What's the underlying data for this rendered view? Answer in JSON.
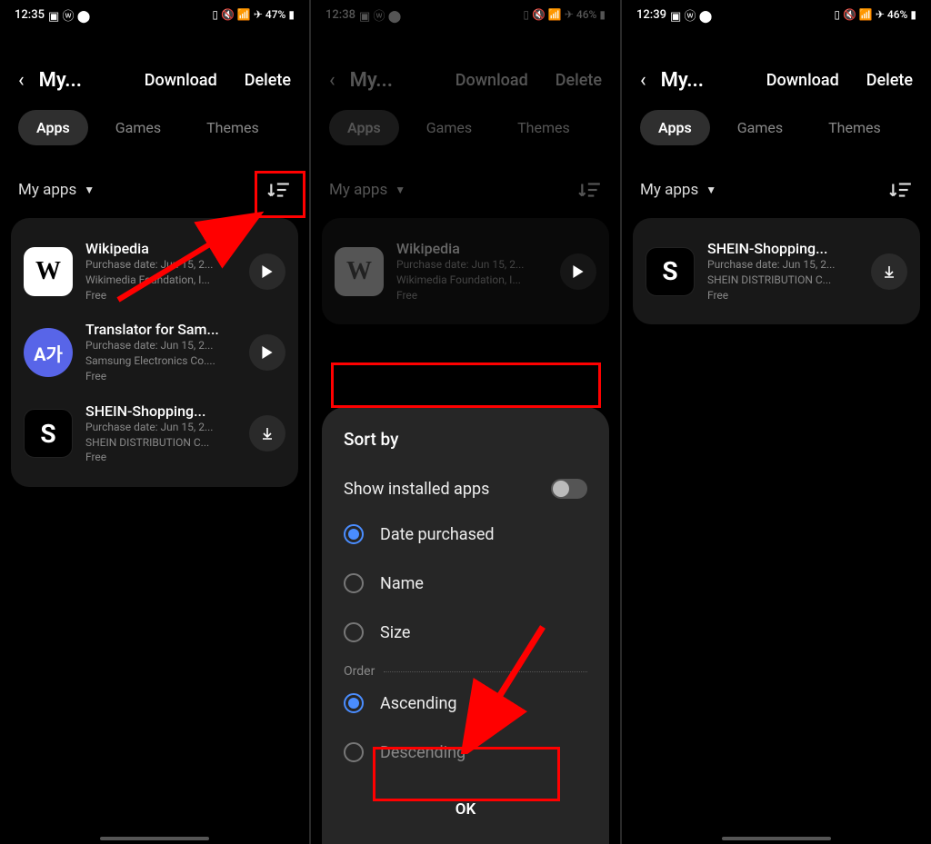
{
  "screens": [
    {
      "status": {
        "time": "12:35",
        "battery": "47%"
      },
      "header": {
        "title": "My...",
        "download": "Download",
        "delete": "Delete"
      },
      "tabs": {
        "apps": "Apps",
        "games": "Games",
        "themes": "Themes"
      },
      "filter": {
        "label": "My apps"
      },
      "apps": [
        {
          "name": "Wikipedia",
          "date": "Purchase date: Jun 15, 2...",
          "vendor": "Wikimedia Foundation, I...",
          "price": "Free",
          "action": "play",
          "iconClass": "wiki",
          "iconText": "W"
        },
        {
          "name": "Translator for Sam...",
          "date": "Purchase date: Jun 15, 2...",
          "vendor": "Samsung Electronics Co....",
          "price": "Free",
          "action": "play",
          "iconClass": "translator",
          "iconText": "A가"
        },
        {
          "name": "SHEIN-Shopping...",
          "date": "Purchase date: Jun 15, 2...",
          "vendor": "SHEIN DISTRIBUTION C...",
          "price": "Free",
          "action": "download",
          "iconClass": "shein",
          "iconText": "S"
        }
      ]
    },
    {
      "status": {
        "time": "12:38",
        "battery": "46%"
      },
      "header": {
        "title": "My...",
        "download": "Download",
        "delete": "Delete"
      },
      "tabs": {
        "apps": "Apps",
        "games": "Games",
        "themes": "Themes"
      },
      "filter": {
        "label": "My apps"
      },
      "apps": [
        {
          "name": "Wikipedia",
          "date": "Purchase date: Jun 15, 2...",
          "vendor": "Wikimedia Foundation, I...",
          "price": "Free",
          "action": "play",
          "iconClass": "wiki",
          "iconText": "W"
        }
      ],
      "sheet": {
        "title": "Sort by",
        "showInstalled": "Show installed apps",
        "options": [
          {
            "label": "Date purchased",
            "selected": true
          },
          {
            "label": "Name",
            "selected": false
          },
          {
            "label": "Size",
            "selected": false
          }
        ],
        "orderLabel": "Order",
        "order": [
          {
            "label": "Ascending",
            "selected": true
          },
          {
            "label": "Descending",
            "selected": false
          }
        ],
        "ok": "OK"
      }
    },
    {
      "status": {
        "time": "12:39",
        "battery": "46%"
      },
      "header": {
        "title": "My...",
        "download": "Download",
        "delete": "Delete"
      },
      "tabs": {
        "apps": "Apps",
        "games": "Games",
        "themes": "Themes"
      },
      "filter": {
        "label": "My apps"
      },
      "apps": [
        {
          "name": "SHEIN-Shopping...",
          "date": "Purchase date: Jun 15, 2...",
          "vendor": "SHEIN DISTRIBUTION C...",
          "price": "Free",
          "action": "download",
          "iconClass": "shein",
          "iconText": "S"
        }
      ]
    }
  ],
  "statusIcons": "◧ ⓦ ●"
}
